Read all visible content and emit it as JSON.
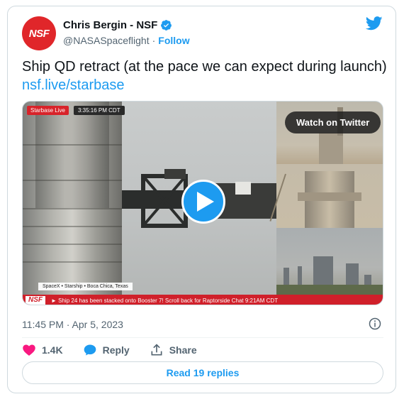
{
  "author": {
    "display_name": "Chris Bergin - NSF",
    "handle": "@NASASpaceflight",
    "follow_label": "Follow",
    "avatar_text": "NSF"
  },
  "tweet": {
    "text": "Ship QD retract (at the pace we can expect during launch)",
    "link": "nsf.live/starbase",
    "timestamp": "11:45 PM · Apr 5, 2023"
  },
  "media": {
    "badge_live": "Starbase Live",
    "badge_time": "3:35:16 PM CDT",
    "location": "SpaceX  •  Starship  •  Boca Chica, Texas",
    "watch_label": "Watch on Twitter",
    "ticker_logo": "NSF",
    "ticker_text": "► Ship 24 has been stacked onto Booster 7! Scroll back for Raptorside Chat 9:21AM CDT"
  },
  "actions": {
    "likes": "1.4K",
    "reply_label": "Reply",
    "share_label": "Share"
  },
  "replies_button": "Read 19 replies",
  "colors": {
    "accent": "#1d9bf0",
    "like": "#f91880",
    "brand_red": "#e0262a"
  }
}
